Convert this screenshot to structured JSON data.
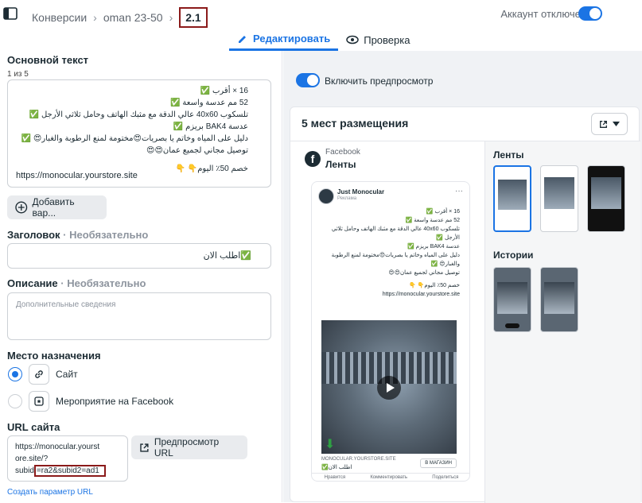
{
  "header": {
    "breadcrumbs": [
      "Конверсии",
      "oman 23-50"
    ],
    "current": "2.1",
    "account_status": "Аккаунт отключен",
    "tabs": [
      {
        "label": "Редактировать",
        "active": true
      },
      {
        "label": "Проверка",
        "active": false
      }
    ]
  },
  "editor": {
    "primary_text_label": "Основной текст",
    "variant_counter": "1 из 5",
    "primary_text_lines": [
      "16 × أقرب ✅",
      "52 مم عدسة واسعة ✅",
      "تلسكوب 40x60 عالي الدقة مع مثبك الهاتف وحامل ثلاثي الأرجل ✅",
      "عدسة BAK4 بريزم ✅",
      "دليل على المياه وخاتم يا بصريات😍مختومة لمنع الرطوبة والغبار😍 ✅",
      "توصيل مجاني لجميع عمان😍😍",
      "",
      "خصم 50٪ اليوم👇 👇"
    ],
    "primary_text_url": "https://monocular.yourstore.site",
    "add_variant_label": "Добавить вар...",
    "headline_label": "Заголовок",
    "optional_suffix": "· Необязательно",
    "headline_value": "✅اطلب الان",
    "description_label": "Описание",
    "description_placeholder": "Дополнительные сведения",
    "destination_label": "Место назначения",
    "destination_options": [
      {
        "label": "Сайт",
        "selected": true,
        "icon": "link-icon"
      },
      {
        "label": "Мероприятие на Facebook",
        "selected": false,
        "icon": "event-icon"
      }
    ],
    "url_label": "URL сайта",
    "url_lines": [
      "https://monocular.yourst",
      "ore.site/?"
    ],
    "url_last_prefix": "subid",
    "url_last_highlight": "=ra2&subid2=ad1",
    "url_preview_button": "Предпросмотр URL",
    "create_param_link": "Создать параметр URL"
  },
  "preview": {
    "toggle_label": "Включить предпросмотр",
    "placements_title": "5 мест размещения",
    "platform": "Facebook",
    "placement": "Ленты",
    "page_name": "Just Monocular",
    "sponsored": "Реклама",
    "ad_url": "https://monocular.yourstore.site",
    "link_domain": "MONOCULAR.YOURSTORE.SITE",
    "link_headline": "✅اطلب الان",
    "cta": "В МАГАЗИН",
    "actions": [
      "Нравится",
      "Комментировать",
      "Поделиться"
    ],
    "feeds_label": "Ленты",
    "stories_label": "Истории"
  }
}
